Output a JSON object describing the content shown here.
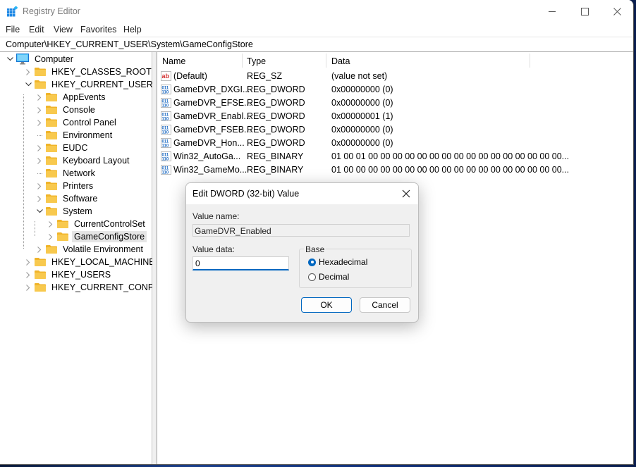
{
  "window": {
    "title": "Registry Editor",
    "controls": {
      "minimize": "minimize",
      "maximize": "maximize",
      "close": "close"
    }
  },
  "menu": [
    "File",
    "Edit",
    "View",
    "Favorites",
    "Help"
  ],
  "address": "Computer\\HKEY_CURRENT_USER\\System\\GameConfigStore",
  "tree": [
    {
      "label": "Computer",
      "level": 0,
      "state": "expanded",
      "icon": "computer-icon"
    },
    {
      "label": "HKEY_CLASSES_ROOT",
      "level": 1,
      "state": "collapsed"
    },
    {
      "label": "HKEY_CURRENT_USER",
      "level": 1,
      "state": "expanded"
    },
    {
      "label": "AppEvents",
      "level": 2,
      "state": "collapsed"
    },
    {
      "label": "Console",
      "level": 2,
      "state": "collapsed"
    },
    {
      "label": "Control Panel",
      "level": 2,
      "state": "collapsed"
    },
    {
      "label": "Environment",
      "level": 2,
      "state": "leaf"
    },
    {
      "label": "EUDC",
      "level": 2,
      "state": "collapsed"
    },
    {
      "label": "Keyboard Layout",
      "level": 2,
      "state": "collapsed"
    },
    {
      "label": "Network",
      "level": 2,
      "state": "leaf"
    },
    {
      "label": "Printers",
      "level": 2,
      "state": "collapsed"
    },
    {
      "label": "Software",
      "level": 2,
      "state": "collapsed"
    },
    {
      "label": "System",
      "level": 2,
      "state": "expanded"
    },
    {
      "label": "CurrentControlSet",
      "level": 3,
      "state": "collapsed"
    },
    {
      "label": "GameConfigStore",
      "level": 3,
      "state": "collapsed",
      "selected": true
    },
    {
      "label": "Volatile Environment",
      "level": 2,
      "state": "collapsed"
    },
    {
      "label": "HKEY_LOCAL_MACHINE",
      "level": 1,
      "state": "collapsed"
    },
    {
      "label": "HKEY_USERS",
      "level": 1,
      "state": "collapsed"
    },
    {
      "label": "HKEY_CURRENT_CONFIG",
      "level": 1,
      "state": "collapsed"
    }
  ],
  "columns": {
    "name": "Name",
    "type": "Type",
    "data": "Data"
  },
  "values": [
    {
      "name": "(Default)",
      "type": "REG_SZ",
      "data": "(value not set)",
      "icon": "string"
    },
    {
      "name": "GameDVR_DXGI...",
      "type": "REG_DWORD",
      "data": "0x00000000 (0)",
      "icon": "binary"
    },
    {
      "name": "GameDVR_EFSE...",
      "type": "REG_DWORD",
      "data": "0x00000000 (0)",
      "icon": "binary"
    },
    {
      "name": "GameDVR_Enabl...",
      "type": "REG_DWORD",
      "data": "0x00000001 (1)",
      "icon": "binary"
    },
    {
      "name": "GameDVR_FSEB...",
      "type": "REG_DWORD",
      "data": "0x00000000 (0)",
      "icon": "binary"
    },
    {
      "name": "GameDVR_Hon...",
      "type": "REG_DWORD",
      "data": "0x00000000 (0)",
      "icon": "binary"
    },
    {
      "name": "Win32_AutoGa...",
      "type": "REG_BINARY",
      "data": "01 00 01 00 00 00 00 00 00 00 00 00 00 00 00 00 00 00 00...",
      "icon": "binary"
    },
    {
      "name": "Win32_GameMo...",
      "type": "REG_BINARY",
      "data": "01 00 00 00 00 00 00 00 00 00 00 00 00 00 00 00 00 00 00...",
      "icon": "binary"
    }
  ],
  "dialog": {
    "title": "Edit DWORD (32-bit) Value",
    "value_name_label": "Value name:",
    "value_name": "GameDVR_Enabled",
    "value_data_label": "Value data:",
    "value_data": "0",
    "base_label": "Base",
    "base_options": [
      "Hexadecimal",
      "Decimal"
    ],
    "base_selected": "Hexadecimal",
    "ok_label": "OK",
    "cancel_label": "Cancel"
  },
  "colors": {
    "accent": "#0067c0",
    "folder": "#f8c94e",
    "selection": "#e5e5e5"
  }
}
